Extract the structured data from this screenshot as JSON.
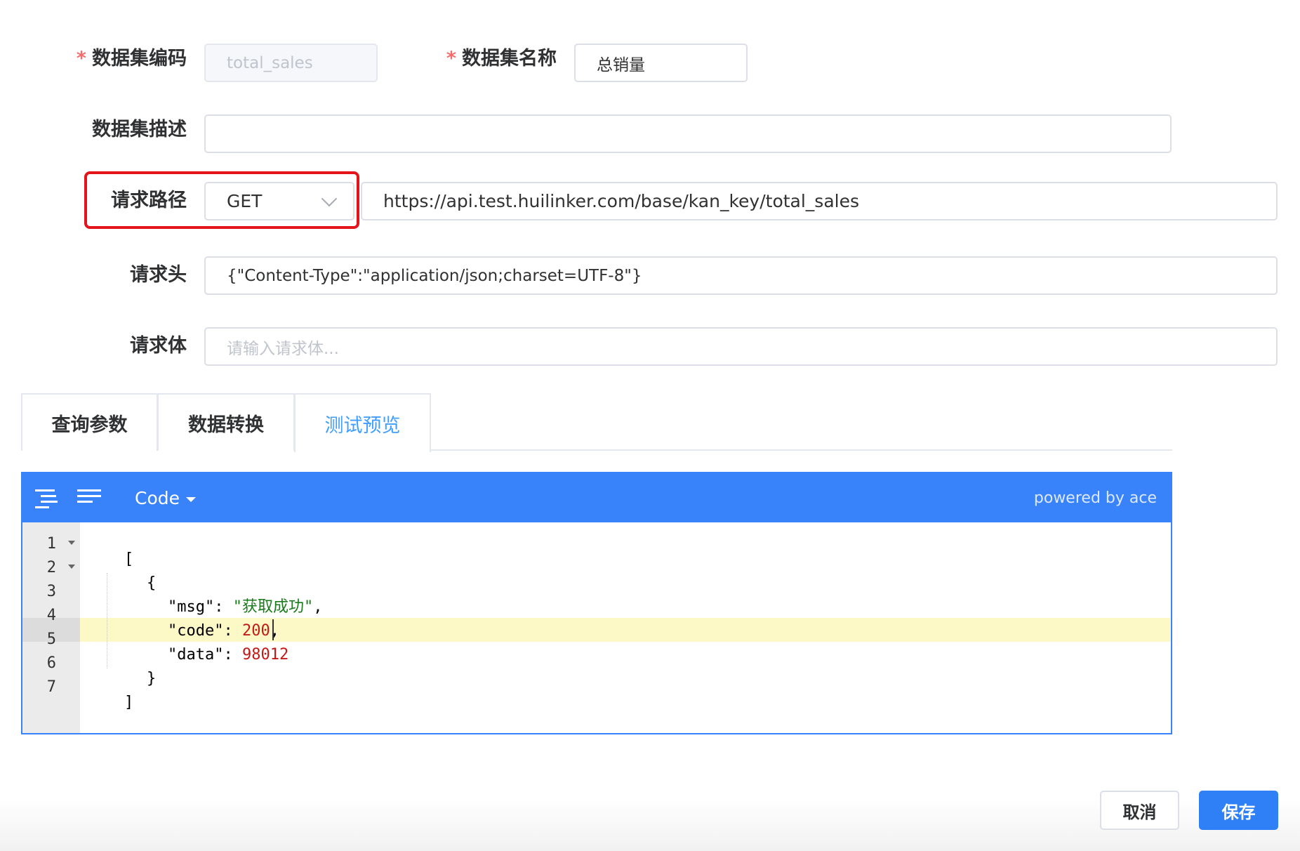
{
  "form": {
    "code": {
      "label": "数据集编码",
      "required_mark": "*",
      "value": "total_sales"
    },
    "name": {
      "label": "数据集名称",
      "required_mark": "*",
      "value": "总销量"
    },
    "description": {
      "label": "数据集描述",
      "value": ""
    },
    "request_path": {
      "label": "请求路径",
      "method": "GET",
      "url": "https://api.test.huilinker.com/base/kan_key/total_sales"
    },
    "request_header": {
      "label": "请求头",
      "value": "{\"Content-Type\":\"application/json;charset=UTF-8\"}"
    },
    "request_body": {
      "label": "请求体",
      "placeholder": "请输入请求体..."
    }
  },
  "tabs": [
    {
      "label": "查询参数",
      "active": false
    },
    {
      "label": "数据转换",
      "active": false
    },
    {
      "label": "测试预览",
      "active": true
    }
  ],
  "editor": {
    "mode_label": "Code",
    "powered_by": "powered by ace",
    "accent_color": "#3883fa",
    "line_numbers": [
      "1",
      "2",
      "3",
      "4",
      "5",
      "6",
      "7"
    ],
    "active_line": 5,
    "lines": {
      "l1": "[",
      "l2": "{",
      "l3_key": "\"msg\"",
      "l3_sep": ": ",
      "l3_val": "\"获取成功\"",
      "l3_end": ",",
      "l4_key": "\"code\"",
      "l4_sep": ": ",
      "l4_val": "200",
      "l4_end": ",",
      "l5_key": "\"data\"",
      "l5_sep": ": ",
      "l5_val": "98012",
      "l6": "}",
      "l7": "]"
    }
  },
  "footer": {
    "cancel_label": "取消",
    "save_label": "保存",
    "primary_color": "#2f80f7"
  },
  "colors": {
    "required": "#f56c6c",
    "highlight": "#e4141b",
    "active_tab": "#409eff"
  }
}
